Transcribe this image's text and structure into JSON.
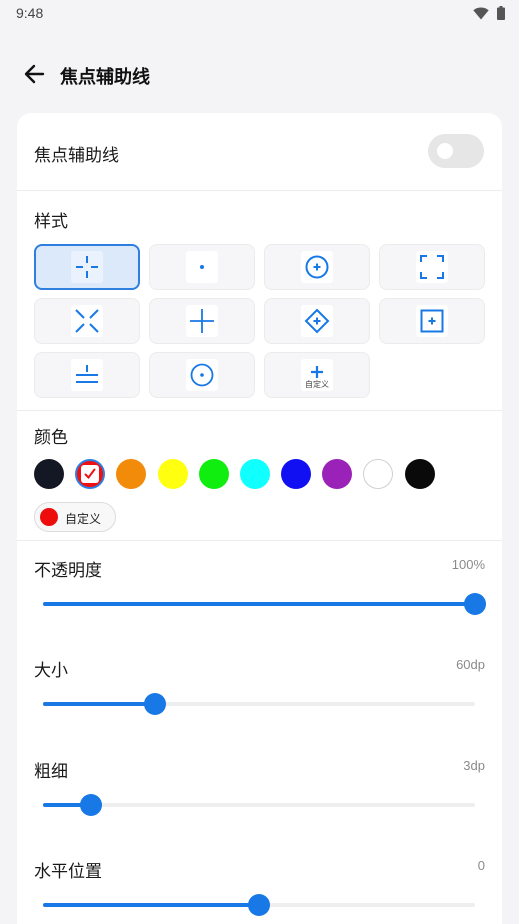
{
  "status_bar": {
    "time": "9:48"
  },
  "app_bar": {
    "title": "焦点辅助线"
  },
  "toggle": {
    "label": "焦点辅助线",
    "on": false
  },
  "style_section": {
    "label": "样式",
    "selected_index": 0,
    "options": [
      {
        "icon": "crosshair-gap-icon"
      },
      {
        "icon": "dot-icon"
      },
      {
        "icon": "circle-plus-icon"
      },
      {
        "icon": "corner-brackets-icon"
      },
      {
        "icon": "diagonal-x-icon"
      },
      {
        "icon": "thin-cross-icon"
      },
      {
        "icon": "diamond-plus-icon"
      },
      {
        "icon": "square-plus-icon"
      },
      {
        "icon": "horizontal-lines-icon"
      },
      {
        "icon": "circle-dot-icon"
      },
      {
        "icon": "custom-plus-icon",
        "label": "自定义"
      }
    ]
  },
  "color_section": {
    "label": "颜色",
    "selected_index": 1,
    "swatches": [
      "#141824",
      "#ee1111",
      "#f28a0a",
      "#ffff10",
      "#10ee10",
      "#10ffff",
      "#1010f2",
      "#9a22b8",
      "#ffffff",
      "#0a0a0a"
    ],
    "custom": {
      "label": "自定义",
      "color": "#ee0d0d"
    }
  },
  "sliders": [
    {
      "label": "不透明度",
      "value_text": "100%",
      "fraction": 1.0
    },
    {
      "label": "大小",
      "value_text": "60dp",
      "fraction": 0.26
    },
    {
      "label": "粗细",
      "value_text": "3dp",
      "fraction": 0.11
    },
    {
      "label": "水平位置",
      "value_text": "0",
      "fraction": 0.5
    }
  ],
  "colors": {
    "accent": "#1778e6"
  }
}
